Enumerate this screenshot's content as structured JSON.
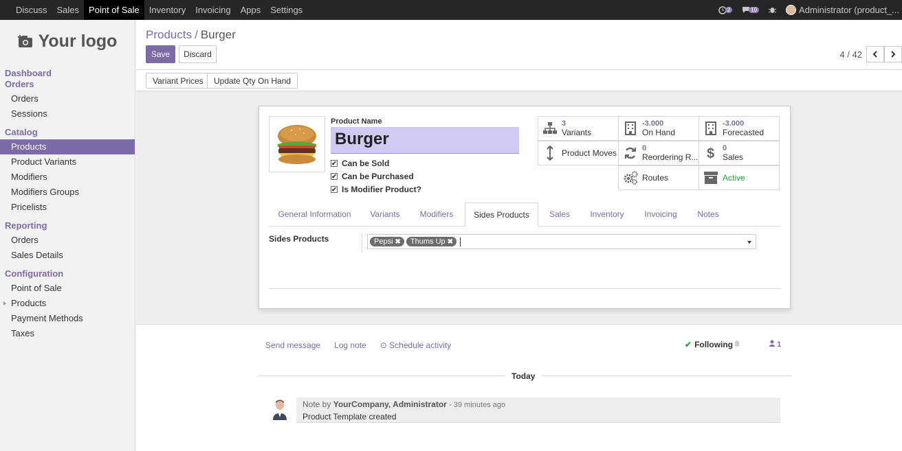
{
  "topbar": {
    "menu": [
      "Discuss",
      "Sales",
      "Point of Sale",
      "Inventory",
      "Invoicing",
      "Apps",
      "Settings"
    ],
    "active_menu": "Point of Sale",
    "activity_count": "2",
    "message_count": "10",
    "user": "Administrator (product_..."
  },
  "sidebar": {
    "logo_text": "Your logo",
    "dashboard": "Dashboard",
    "sections": [
      {
        "title": "Orders",
        "items": [
          "Orders",
          "Sessions"
        ]
      },
      {
        "title": "Catalog",
        "items": [
          "Products",
          "Product Variants",
          "Modifiers",
          "Modifiers Groups",
          "Pricelists"
        ]
      },
      {
        "title": "Reporting",
        "items": [
          "Orders",
          "Sales Details"
        ]
      },
      {
        "title": "Configuration",
        "items": [
          "Point of Sale",
          "Products",
          "Payment Methods",
          "Taxes"
        ]
      }
    ],
    "active_item": "Products"
  },
  "control": {
    "breadcrumb_parent": "Products",
    "breadcrumb_sep": "/",
    "breadcrumb_current": "Burger",
    "save_label": "Save",
    "discard_label": "Discard",
    "pager": "4 / 42"
  },
  "statusbar": {
    "variant_prices": "Variant Prices",
    "update_qty": "Update Qty On Hand"
  },
  "form": {
    "product_name_label": "Product Name",
    "product_name": "Burger",
    "checkboxes": [
      {
        "label": "Can be Sold",
        "checked": true
      },
      {
        "label": "Can be Purchased",
        "checked": true
      },
      {
        "label": "Is Modifier Product?",
        "checked": true
      }
    ],
    "smart_buttons": {
      "variants_count": "3",
      "variants_label": "Variants",
      "on_hand_value": "-3.000",
      "on_hand_label": "On Hand",
      "forecasted_value": "-3.000",
      "forecasted_label": "Forecasted",
      "product_moves": "Product Moves",
      "reordering_count": "0",
      "reordering_label": "Reordering R...",
      "sales_count": "0",
      "sales_label": "Sales",
      "routes": "Routes",
      "active": "Active"
    },
    "tabs": [
      "General Information",
      "Variants",
      "Modifiers",
      "Sides Products",
      "Sales",
      "Inventory",
      "Invoicing",
      "Notes"
    ],
    "active_tab": "Sides Products",
    "sides_products_label": "Sides Products",
    "sides_products": [
      "Pepsi",
      "Thums Up"
    ]
  },
  "chatter": {
    "send_message": "Send message",
    "log_note": "Log note",
    "schedule_activity": "Schedule activity",
    "following": "Following",
    "followers_count": "1",
    "today": "Today",
    "note_by": "Note by",
    "author": "YourCompany, Administrator",
    "time": "- 39 minutes ago",
    "body": "Product Template created"
  },
  "colors": {
    "brand": "#7c6ba6",
    "name_highlight": "#d2c9f5",
    "active_green": "#28a745"
  }
}
